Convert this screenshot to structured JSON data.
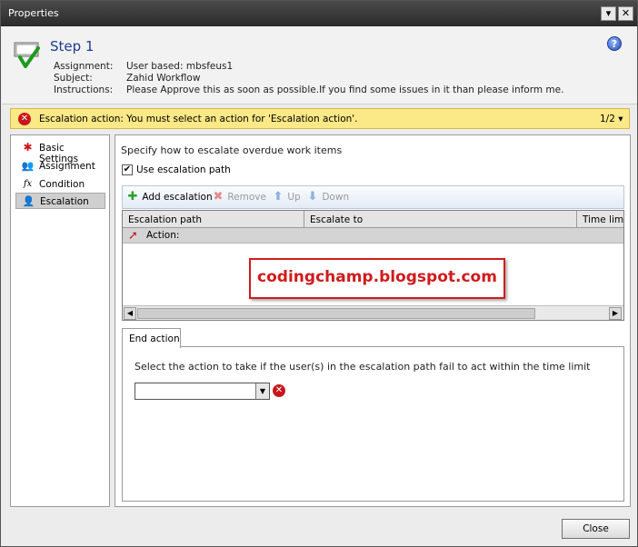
{
  "window": {
    "title": "Properties",
    "menu_glyph": "▾",
    "close_glyph": "✕"
  },
  "header": {
    "step_title": "Step 1",
    "help_glyph": "?",
    "assignment_label": "Assignment:",
    "assignment_value": "User based: mbsfeus1",
    "subject_label": "Subject:",
    "subject_value": "Zahid Workflow",
    "instructions_label": "Instructions:",
    "instructions_value": "Please Approve this as soon as possible.If you find some issues in it than please inform me."
  },
  "error_bar": {
    "icon_glyph": "✕",
    "message": "Escalation action: You must select an action for 'Escalation action'.",
    "pager": "1/2 ▾"
  },
  "sidebar": {
    "items": [
      {
        "label": "Basic Settings",
        "icon": "asterisk-icon",
        "glyph": "✱"
      },
      {
        "label": "Assignment",
        "icon": "users-icon",
        "glyph": "👥"
      },
      {
        "label": "Condition",
        "icon": "function-icon",
        "glyph": "fx"
      },
      {
        "label": "Escalation",
        "icon": "escalation-icon",
        "glyph": "👤"
      }
    ],
    "selected": "Escalation"
  },
  "main": {
    "heading": "Specify how to escalate overdue work items",
    "use_escalation_path": {
      "label": "Use escalation path",
      "checked": true,
      "glyph": "✔"
    },
    "toolbar": {
      "add": {
        "label": "Add escalation",
        "glyph": "✚"
      },
      "remove": {
        "label": "Remove",
        "glyph": "✖"
      },
      "up": {
        "label": "Up",
        "glyph": "⬆"
      },
      "down": {
        "label": "Down",
        "glyph": "⬇"
      }
    },
    "grid": {
      "columns": [
        "Escalation path",
        "Escalate to",
        "Time limit"
      ],
      "group_row": {
        "label": "Action:",
        "glyph": "➚"
      },
      "scroll_left": "◀",
      "scroll_right": "▶"
    },
    "watermark": "codingchamp.blogspot.com",
    "end_action": {
      "tab_label": "End action",
      "prompt": "Select the action to take if the user(s) in the escalation path fail to act within the time limit",
      "dropdown_value": "",
      "dropdown_arrow": "▼",
      "error_glyph": "✕"
    }
  },
  "footer": {
    "close_label": "Close"
  },
  "colors": {
    "accent": "#1c3d8c",
    "error": "#c8161b",
    "warning_bg": "#fbe886",
    "watermark": "#d11b1b"
  }
}
